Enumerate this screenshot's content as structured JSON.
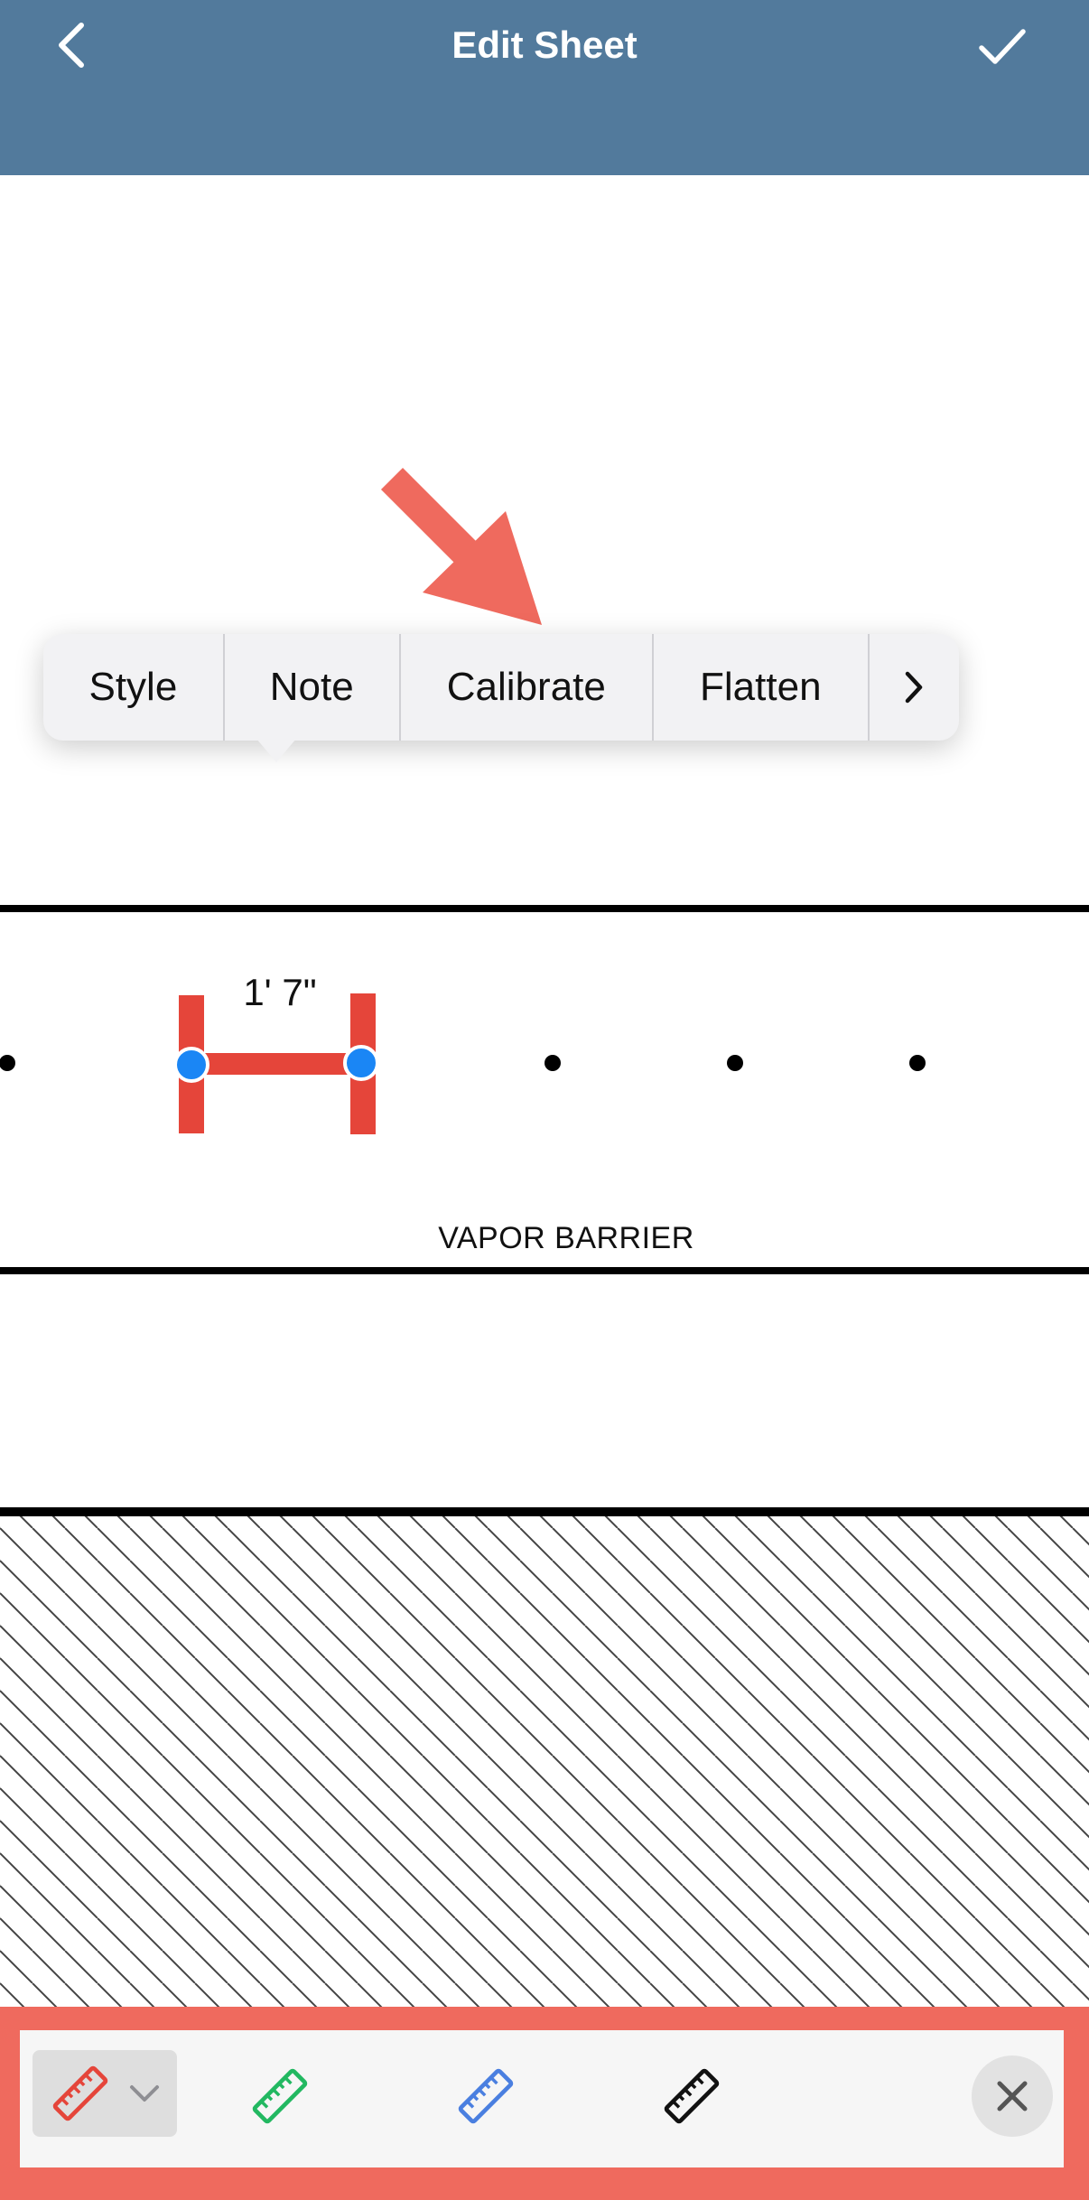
{
  "nav": {
    "title": "Edit Sheet",
    "back_icon": "chevron-left-icon",
    "done_icon": "checkmark-icon",
    "background_color": "#527a9c"
  },
  "context_menu": {
    "items": [
      "Style",
      "Note",
      "Calibrate",
      "Flatten"
    ],
    "more_icon": "chevron-right-icon"
  },
  "drawing": {
    "measurement_label": "1' 7\"",
    "layer_label": "VAPOR BARRIER",
    "measurement_color": "#e5453a",
    "handle_color": "#1a86f5"
  },
  "annotation": {
    "arrow_color": "#ef6a5e",
    "highlight_color": "#ef6a5e"
  },
  "toolbar": {
    "tools": [
      {
        "icon": "ruler-icon",
        "color": "#e5453a",
        "selected": true
      },
      {
        "icon": "ruler-icon",
        "color": "#22b861",
        "selected": false
      },
      {
        "icon": "ruler-icon",
        "color": "#4a7fe0",
        "selected": false
      },
      {
        "icon": "ruler-icon",
        "color": "#111111",
        "selected": false
      }
    ],
    "dropdown_icon": "chevron-down-icon",
    "close_icon": "close-icon"
  }
}
